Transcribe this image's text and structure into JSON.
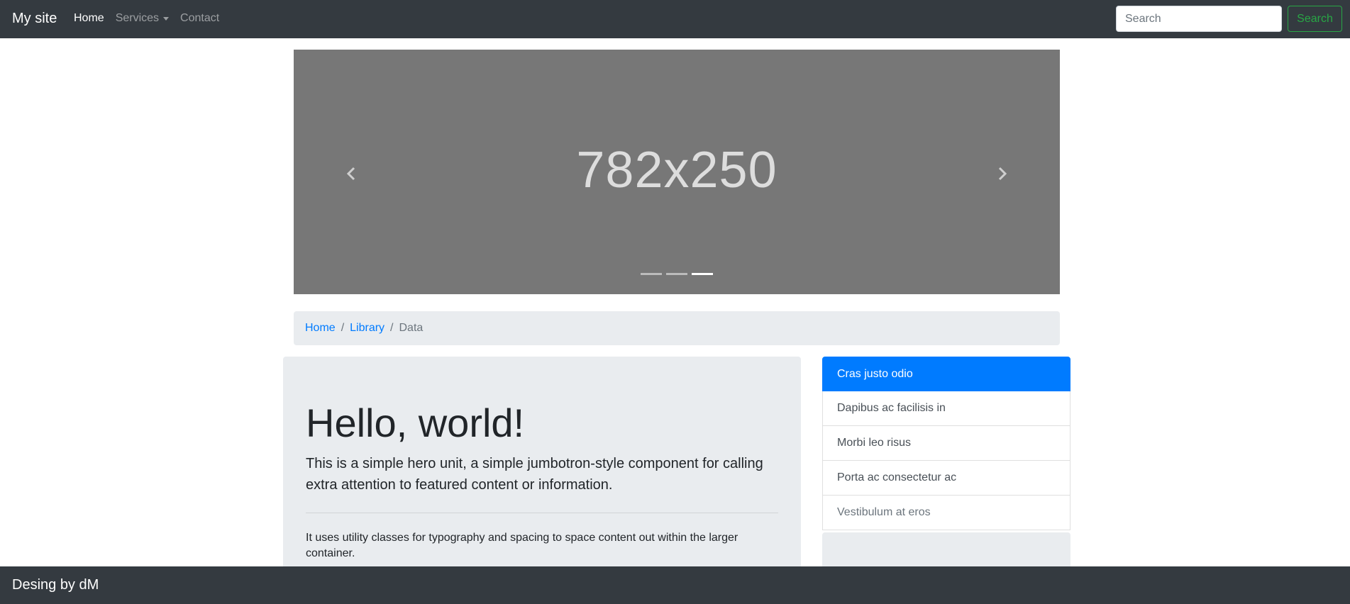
{
  "navbar": {
    "brand": "My site",
    "items": [
      {
        "label": "Home",
        "active": true
      },
      {
        "label": "Services",
        "dropdown": true
      },
      {
        "label": "Contact"
      }
    ],
    "search_placeholder": "Search",
    "search_button": "Search"
  },
  "carousel": {
    "image_text": "782x250",
    "indicator_count": 3,
    "active_indicator": 3
  },
  "breadcrumb": {
    "items": [
      {
        "label": "Home",
        "link": true
      },
      {
        "label": "Library",
        "link": true
      },
      {
        "label": "Data",
        "link": false
      }
    ]
  },
  "jumbotron": {
    "title": "Hello, world!",
    "lead": "This is a simple hero unit, a simple jumbotron-style component for calling extra attention to featured content or information.",
    "text": "It uses utility classes for typography and spacing to space content out within the larger container."
  },
  "list_group": {
    "items": [
      {
        "label": "Cras justo odio",
        "state": "active"
      },
      {
        "label": "Dapibus ac facilisis in",
        "state": "normal"
      },
      {
        "label": "Morbi leo risus",
        "state": "normal"
      },
      {
        "label": "Porta ac consectetur ac",
        "state": "normal"
      },
      {
        "label": "Vestibulum at eros",
        "state": "disabled"
      }
    ]
  },
  "footer": {
    "text": "Desing by dM"
  },
  "colors": {
    "navbar_bg": "#343a40",
    "primary": "#007bff",
    "success": "#28a745",
    "carousel_bg": "#777777",
    "light_bg": "#e9ecef"
  },
  "icons": {
    "carousel_prev": "chevron-left-icon",
    "carousel_next": "chevron-right-icon",
    "dropdown": "caret-down-icon"
  }
}
